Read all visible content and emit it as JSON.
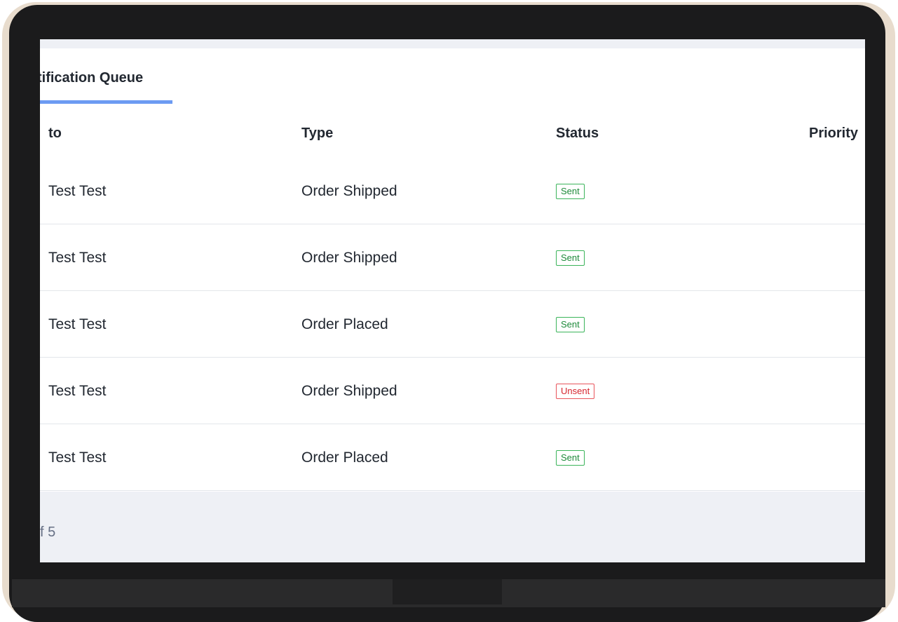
{
  "tab": {
    "title": "tification Queue"
  },
  "table": {
    "headers": {
      "to": "to",
      "type": "Type",
      "status": "Status",
      "priority": "Priority"
    },
    "rows": [
      {
        "to": "Test Test",
        "type": "Order Shipped",
        "status": "Sent"
      },
      {
        "to": "Test Test",
        "type": "Order Shipped",
        "status": "Sent"
      },
      {
        "to": "Test Test",
        "type": "Order Placed",
        "status": "Sent"
      },
      {
        "to": "Test Test",
        "type": "Order Shipped",
        "status": "Unsent"
      },
      {
        "to": "Test Test",
        "type": "Order Placed",
        "status": "Sent"
      }
    ]
  },
  "footer": {
    "pagination_text": "f 5"
  },
  "colors": {
    "accent": "#6c9bf2",
    "sent": "#1e8a3a",
    "unsent": "#d6252e",
    "footer_bg": "#eef0f5"
  }
}
